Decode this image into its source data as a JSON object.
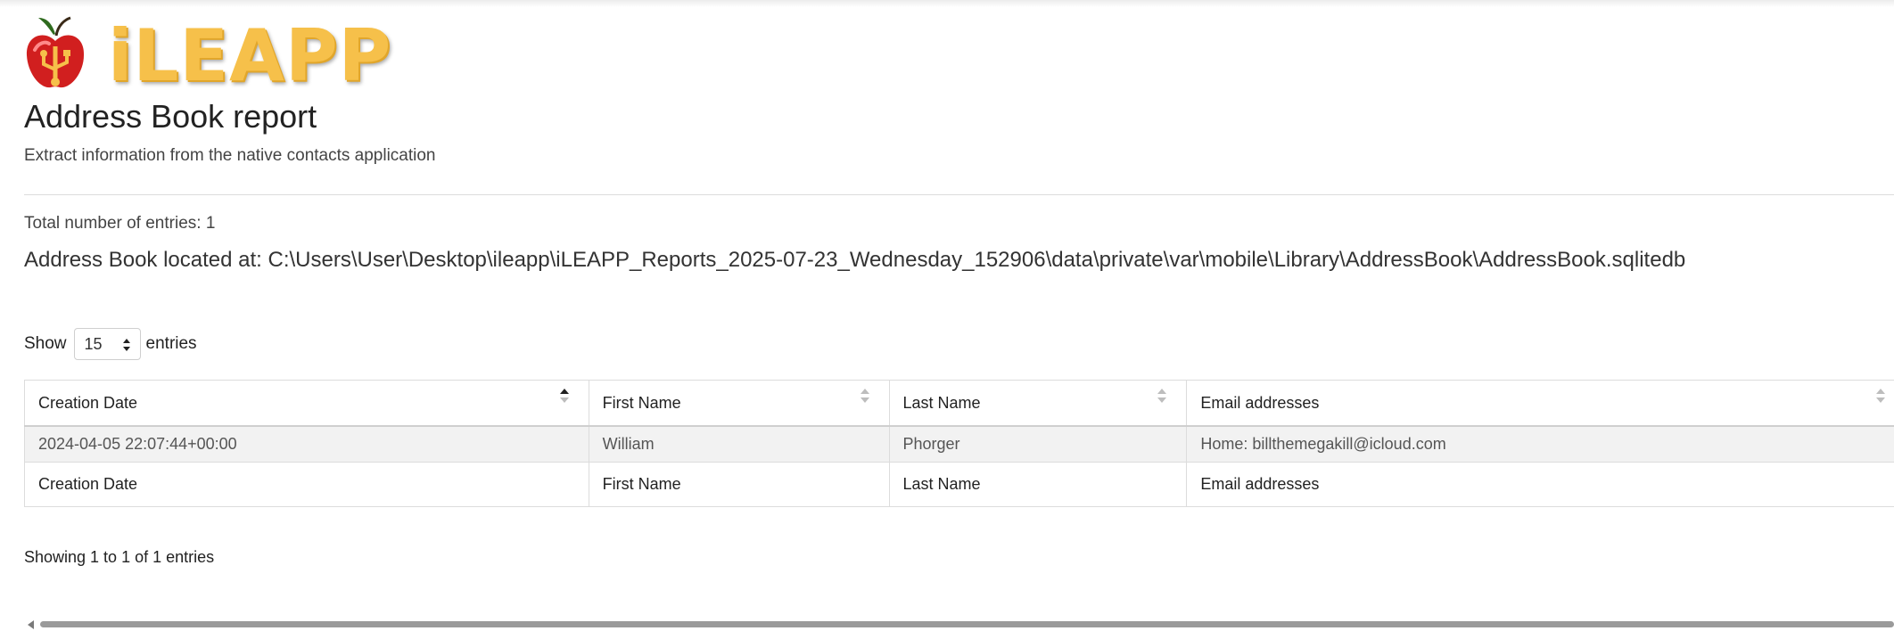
{
  "logo": {
    "text": "iLEAPP"
  },
  "page": {
    "title": "Address Book report",
    "subtitle": "Extract information from the native contacts application",
    "total_entries": "Total number of entries: 1",
    "location": "Address Book located at: C:\\Users\\User\\Desktop\\ileapp\\iLEAPP_Reports_2025-07-23_Wednesday_152906\\data\\private\\var\\mobile\\Library\\AddressBook\\AddressBook.sqlitedb"
  },
  "table_controls": {
    "show_label": "Show",
    "page_length": "15",
    "entries_label": "entries"
  },
  "table": {
    "columns": [
      "Creation Date",
      "First Name",
      "Last Name",
      "Email addresses"
    ],
    "rows": [
      [
        "2024-04-05 22:07:44+00:00",
        "William",
        "Phorger",
        "Home: billthemegakill@icloud.com"
      ]
    ],
    "sorted_column": "Creation Date",
    "sort_direction": "ascending"
  },
  "footer": {
    "info": "Showing 1 to 1 of 1 entries"
  },
  "icons": {
    "logo": "apple-usb-icon",
    "select": "select-caret-icon",
    "sort": "sort-arrows-icon",
    "scroll": "scroll-left-arrow-icon"
  },
  "colors": {
    "logo_text": "#f6c04a",
    "row_background": "#f2f2f2"
  }
}
